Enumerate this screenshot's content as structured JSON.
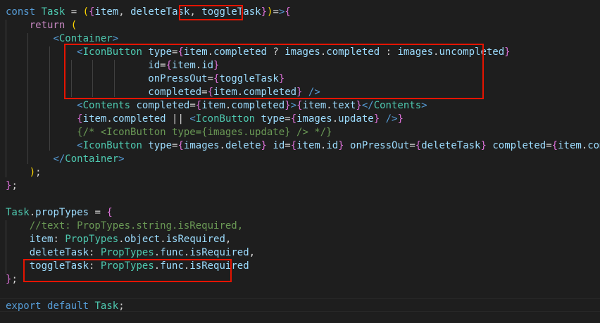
{
  "editor": {
    "theme_bg": "#1e1e1e",
    "lines": [
      "const Task = ({item, deleteTask, toggleTask})=>{",
      "    return (",
      "        <Container>",
      "            <IconButton type={item.completed ? images.completed : images.uncompleted}",
      "                        id={item.id}",
      "                        onPressOut={toggleTask}",
      "                        completed={item.completed} />",
      "            <Contents completed={item.completed}>{item.text}</Contents>",
      "            {item.completed || <IconButton type={images.update} />}",
      "            {/* <IconButton type={images.update} /> */}",
      "            <IconButton type={images.delete} id={item.id} onPressOut={deleteTask} completed={item.completed}/>",
      "        </Container>",
      "    );",
      "};",
      "",
      "Task.propTypes = {",
      "    //text: PropTypes.string.isRequired,",
      "    item: PropTypes.object.isRequired,",
      "    deleteTask: PropTypes.func.isRequired,",
      "    toggleTask: PropTypes.func.isRequired",
      "};",
      "",
      "export default Task;"
    ],
    "highlight_color": "#e51400"
  }
}
